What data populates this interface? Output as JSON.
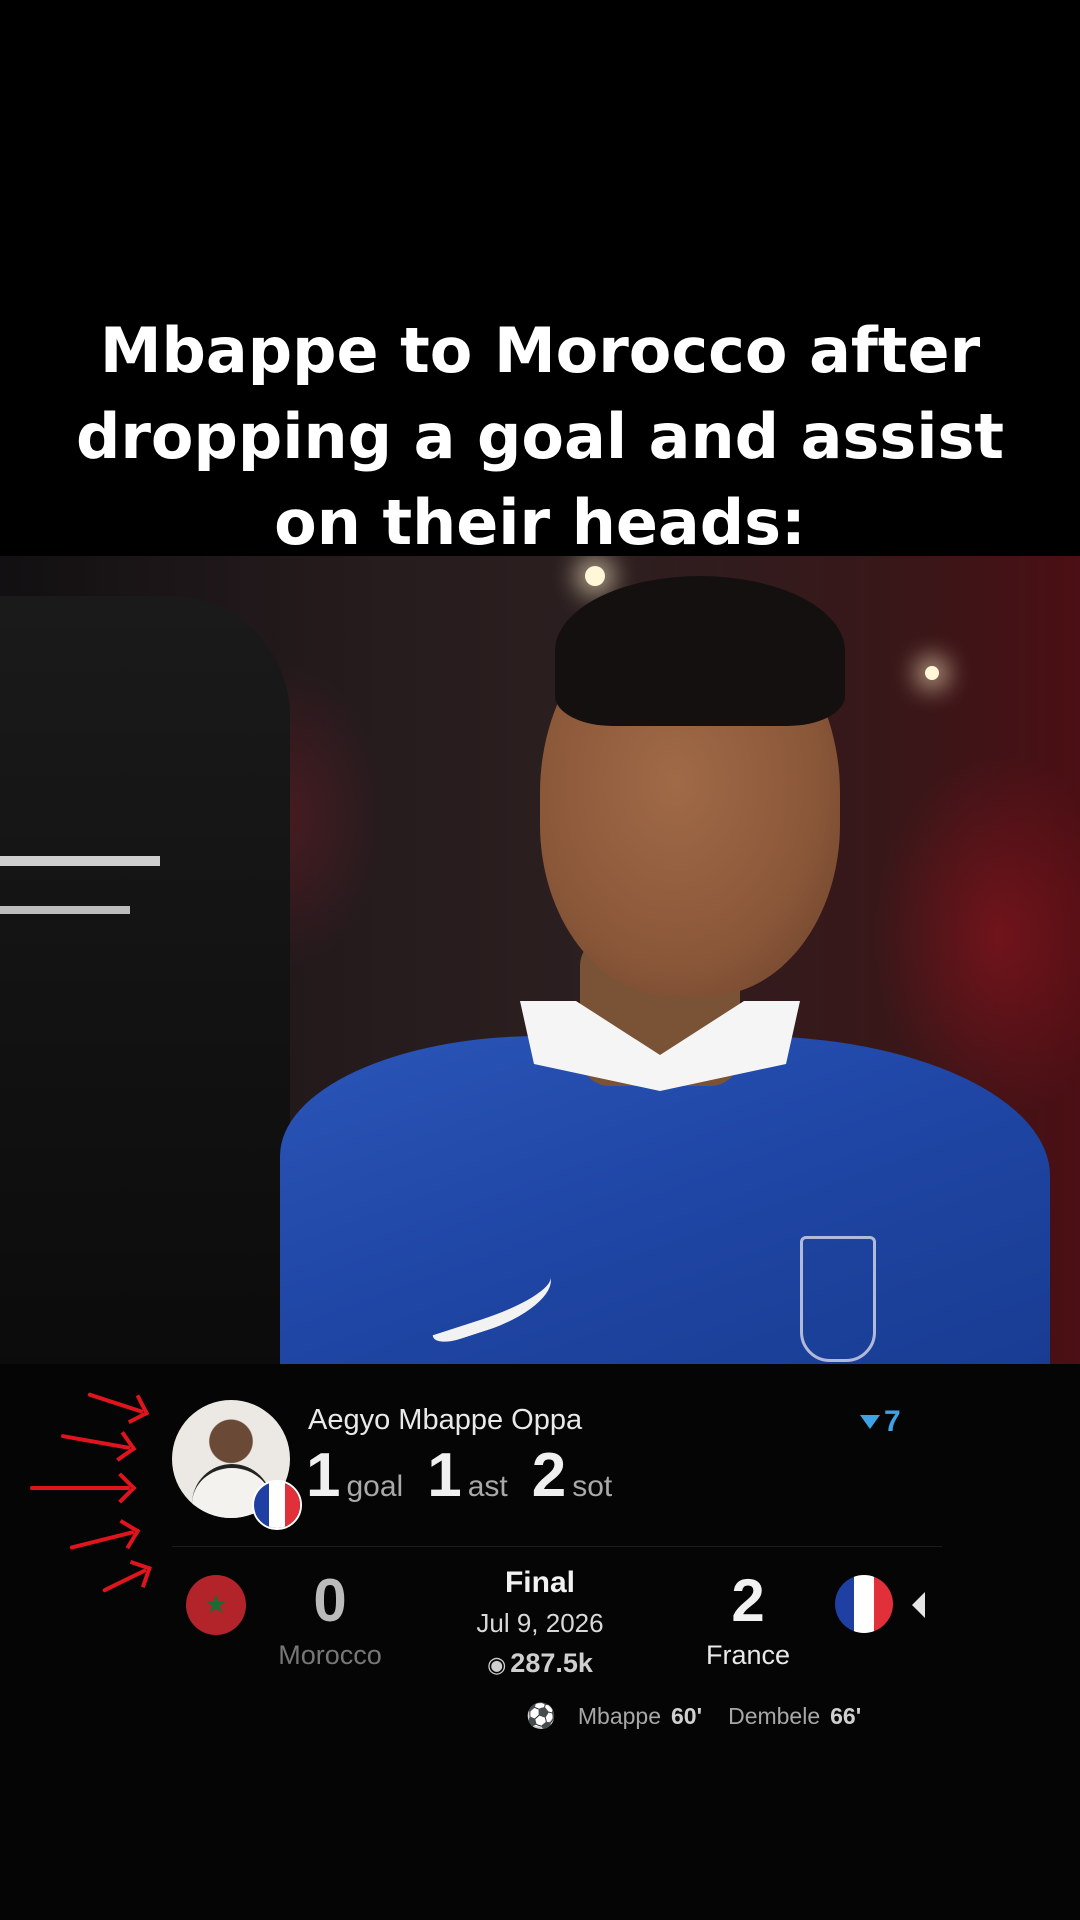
{
  "caption": {
    "lines": [
      "Mbappe to Morocco after",
      "dropping a goal and assist",
      "on their heads:"
    ]
  },
  "player": {
    "name": "Aegyo Mbappe Oppa",
    "stats": [
      {
        "value": "1",
        "label": "goal"
      },
      {
        "value": "1",
        "label": "ast"
      },
      {
        "value": "2",
        "label": "sot"
      }
    ],
    "badge_count": "7"
  },
  "match": {
    "status": "Final",
    "date": "Jul 9, 2026",
    "views": "287.5k",
    "home": {
      "name": "Morocco",
      "score": "0"
    },
    "away": {
      "name": "France",
      "score": "2"
    },
    "scorers": [
      {
        "name": "Mbappe",
        "minute": "60'"
      },
      {
        "name": "Dembele",
        "minute": "66'"
      }
    ]
  },
  "colors": {
    "accent_blue": "#3ea3e6",
    "arrow_red": "#e0141c",
    "morocco_red": "#b3232a",
    "france_blue": "#1f3fa3",
    "france_red": "#e1303a"
  },
  "icons": [
    "filter-icon",
    "eye-icon",
    "soccer-ball-icon",
    "collapse-triangle-icon",
    "france-flag-icon",
    "morocco-flag-icon"
  ]
}
